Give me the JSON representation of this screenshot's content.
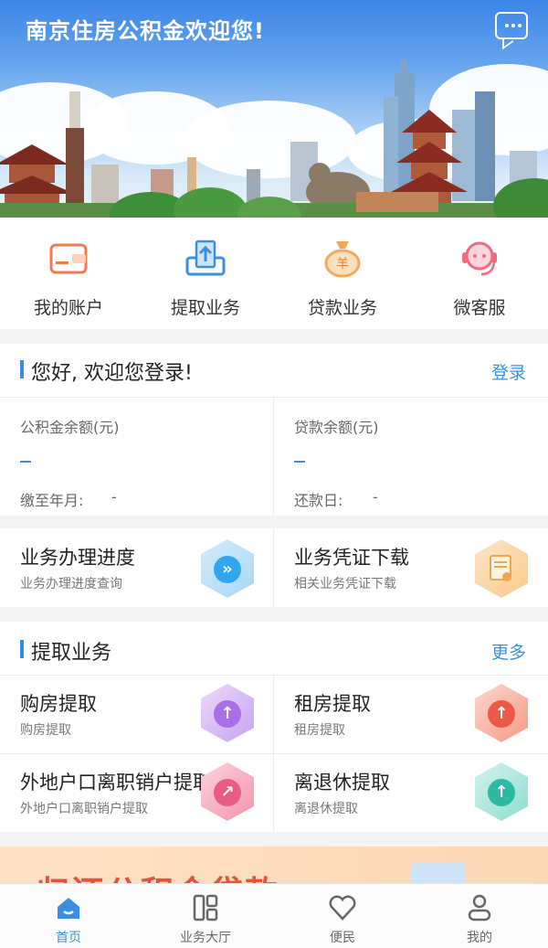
{
  "header": {
    "title": "南京住房公积金欢迎您!",
    "message_icon": "message-icon"
  },
  "quick_menu": [
    {
      "label": "我的账户",
      "icon": "wallet-icon"
    },
    {
      "label": "提取业务",
      "icon": "withdraw-icon"
    },
    {
      "label": "贷款业务",
      "icon": "money-bag-icon"
    },
    {
      "label": "微客服",
      "icon": "customer-service-icon"
    }
  ],
  "welcome": {
    "title": "您好, 欢迎您登录!",
    "login": "登录",
    "left": {
      "label": "公积金余额(元)",
      "value": "–",
      "sub_label": "缴至年月:",
      "sub_value": "-"
    },
    "right": {
      "label": "贷款余额(元)",
      "value": "–",
      "sub_label": "还款日:",
      "sub_value": "-"
    }
  },
  "service_cards": [
    {
      "title": "业务办理进度",
      "subtitle": "业务办理进度查询",
      "icon": "progress-icon"
    },
    {
      "title": "业务凭证下载",
      "subtitle": "相关业务凭证下载",
      "icon": "certificate-icon"
    }
  ],
  "withdraw": {
    "title": "提取业务",
    "more": "更多",
    "items": [
      {
        "title": "购房提取",
        "subtitle": "购房提取",
        "icon": "house-upload-icon"
      },
      {
        "title": "租房提取",
        "subtitle": "租房提取",
        "icon": "money-bag-upload-icon"
      },
      {
        "title": "外地户口离职销户提取",
        "subtitle": "外地户口离职销户提取",
        "icon": "house-share-icon"
      },
      {
        "title": "离退休提取",
        "subtitle": "离退休提取",
        "icon": "cup-upload-icon"
      }
    ]
  },
  "promo": {
    "text": "归还公积金贷款"
  },
  "tabbar": [
    {
      "label": "首页",
      "icon": "home-icon",
      "active": true
    },
    {
      "label": "业务大厅",
      "icon": "grid-icon",
      "active": false
    },
    {
      "label": "便民",
      "icon": "heart-icon",
      "active": false
    },
    {
      "label": "我的",
      "icon": "person-icon",
      "active": false
    }
  ],
  "colors": {
    "accent": "#3b8fe0",
    "orange": "#e8823a",
    "promo_red": "#e2543a"
  }
}
